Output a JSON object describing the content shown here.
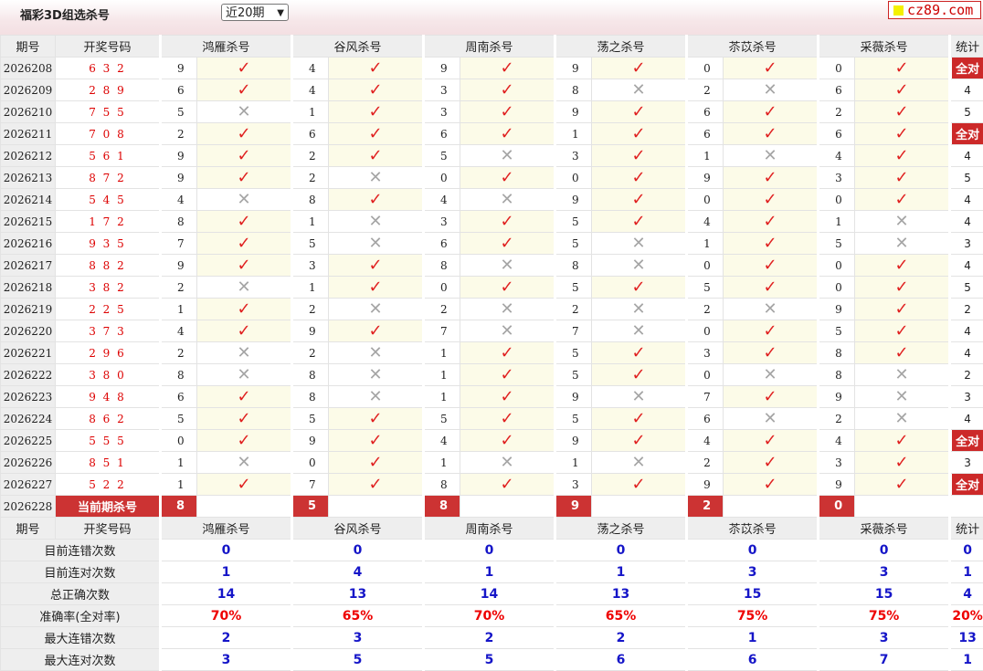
{
  "header": {
    "title": "福彩3D组选杀号",
    "period_select": "近20期",
    "logo": "cz89.com"
  },
  "columns": {
    "period": "期号",
    "draw": "开奖号码",
    "experts": [
      "鸿雁杀号",
      "谷风杀号",
      "周南杀号",
      "荡之杀号",
      "苶苡杀号",
      "采薇杀号"
    ],
    "stat": "统计"
  },
  "rows": [
    {
      "p": "2026208",
      "d": "6 3 2",
      "k": [
        9,
        4,
        9,
        9,
        0,
        0
      ],
      "r": [
        1,
        1,
        1,
        1,
        1,
        1
      ],
      "s": "全对"
    },
    {
      "p": "2026209",
      "d": "2 8 9",
      "k": [
        6,
        4,
        3,
        8,
        2,
        6
      ],
      "r": [
        1,
        1,
        1,
        0,
        0,
        1
      ],
      "s": "4"
    },
    {
      "p": "2026210",
      "d": "7 5 5",
      "k": [
        5,
        1,
        3,
        9,
        6,
        2
      ],
      "r": [
        0,
        1,
        1,
        1,
        1,
        1
      ],
      "s": "5"
    },
    {
      "p": "2026211",
      "d": "7 0 8",
      "k": [
        2,
        6,
        6,
        1,
        6,
        6
      ],
      "r": [
        1,
        1,
        1,
        1,
        1,
        1
      ],
      "s": "全对"
    },
    {
      "p": "2026212",
      "d": "5 6 1",
      "k": [
        9,
        2,
        5,
        3,
        1,
        4
      ],
      "r": [
        1,
        1,
        0,
        1,
        0,
        1
      ],
      "s": "4"
    },
    {
      "p": "2026213",
      "d": "8 7 2",
      "k": [
        9,
        2,
        0,
        0,
        9,
        3
      ],
      "r": [
        1,
        0,
        1,
        1,
        1,
        1
      ],
      "s": "5"
    },
    {
      "p": "2026214",
      "d": "5 4 5",
      "k": [
        4,
        8,
        4,
        9,
        0,
        0
      ],
      "r": [
        0,
        1,
        0,
        1,
        1,
        1
      ],
      "s": "4"
    },
    {
      "p": "2026215",
      "d": "1 7 2",
      "k": [
        8,
        1,
        3,
        5,
        4,
        1
      ],
      "r": [
        1,
        0,
        1,
        1,
        1,
        0
      ],
      "s": "4"
    },
    {
      "p": "2026216",
      "d": "9 3 5",
      "k": [
        7,
        5,
        6,
        5,
        1,
        5
      ],
      "r": [
        1,
        0,
        1,
        0,
        1,
        0
      ],
      "s": "3"
    },
    {
      "p": "2026217",
      "d": "8 8 2",
      "k": [
        9,
        3,
        8,
        8,
        0,
        0
      ],
      "r": [
        1,
        1,
        0,
        0,
        1,
        1
      ],
      "s": "4"
    },
    {
      "p": "2026218",
      "d": "3 8 2",
      "k": [
        2,
        1,
        0,
        5,
        5,
        0
      ],
      "r": [
        0,
        1,
        1,
        1,
        1,
        1
      ],
      "s": "5"
    },
    {
      "p": "2026219",
      "d": "2 2 5",
      "k": [
        1,
        2,
        2,
        2,
        2,
        9
      ],
      "r": [
        1,
        0,
        0,
        0,
        0,
        1
      ],
      "s": "2"
    },
    {
      "p": "2026220",
      "d": "3 7 3",
      "k": [
        4,
        9,
        7,
        7,
        0,
        5
      ],
      "r": [
        1,
        1,
        0,
        0,
        1,
        1
      ],
      "s": "4"
    },
    {
      "p": "2026221",
      "d": "2 9 6",
      "k": [
        2,
        2,
        1,
        5,
        3,
        8
      ],
      "r": [
        0,
        0,
        1,
        1,
        1,
        1
      ],
      "s": "4"
    },
    {
      "p": "2026222",
      "d": "3 8 0",
      "k": [
        8,
        8,
        1,
        5,
        0,
        8
      ],
      "r": [
        0,
        0,
        1,
        1,
        0,
        0
      ],
      "s": "2"
    },
    {
      "p": "2026223",
      "d": "9 4 8",
      "k": [
        6,
        8,
        1,
        9,
        7,
        9
      ],
      "r": [
        1,
        0,
        1,
        0,
        1,
        0
      ],
      "s": "3"
    },
    {
      "p": "2026224",
      "d": "8 6 2",
      "k": [
        5,
        5,
        5,
        5,
        6,
        2
      ],
      "r": [
        1,
        1,
        1,
        1,
        0,
        0
      ],
      "s": "4"
    },
    {
      "p": "2026225",
      "d": "5 5 5",
      "k": [
        0,
        9,
        4,
        9,
        4,
        4
      ],
      "r": [
        1,
        1,
        1,
        1,
        1,
        1
      ],
      "s": "全对"
    },
    {
      "p": "2026226",
      "d": "8 5 1",
      "k": [
        1,
        0,
        1,
        1,
        2,
        3
      ],
      "r": [
        0,
        1,
        0,
        0,
        1,
        1
      ],
      "s": "3"
    },
    {
      "p": "2026227",
      "d": "5 2 2",
      "k": [
        1,
        7,
        8,
        3,
        9,
        9
      ],
      "r": [
        1,
        1,
        1,
        1,
        1,
        1
      ],
      "s": "全对"
    }
  ],
  "current": {
    "period": "2026228",
    "label": "当前期杀号",
    "kills": [
      8,
      5,
      8,
      9,
      2,
      0
    ]
  },
  "stats": [
    {
      "label": "目前连错次数",
      "vals": [
        "0",
        "0",
        "0",
        "0",
        "0",
        "0",
        "0"
      ],
      "color": "blue"
    },
    {
      "label": "目前连对次数",
      "vals": [
        "1",
        "4",
        "1",
        "1",
        "3",
        "3",
        "1"
      ],
      "color": "blue"
    },
    {
      "label": "总正确次数",
      "vals": [
        "14",
        "13",
        "14",
        "13",
        "15",
        "15",
        "4"
      ],
      "color": "blue"
    },
    {
      "label": "准确率(全对率)",
      "vals": [
        "70%",
        "65%",
        "70%",
        "65%",
        "75%",
        "75%",
        "20%"
      ],
      "color": "red"
    },
    {
      "label": "最大连错次数",
      "vals": [
        "2",
        "3",
        "2",
        "2",
        "1",
        "3",
        "13"
      ],
      "color": "blue"
    },
    {
      "label": "最大连对次数",
      "vals": [
        "3",
        "5",
        "5",
        "6",
        "6",
        "7",
        "1"
      ],
      "color": "blue"
    }
  ],
  "icons": {
    "correct": "check-icon",
    "wrong": "cross-icon"
  },
  "colors": {
    "accent_red": "#cc3333",
    "stat_blue": "#1515c8",
    "highlight": "#fcfbe8"
  }
}
